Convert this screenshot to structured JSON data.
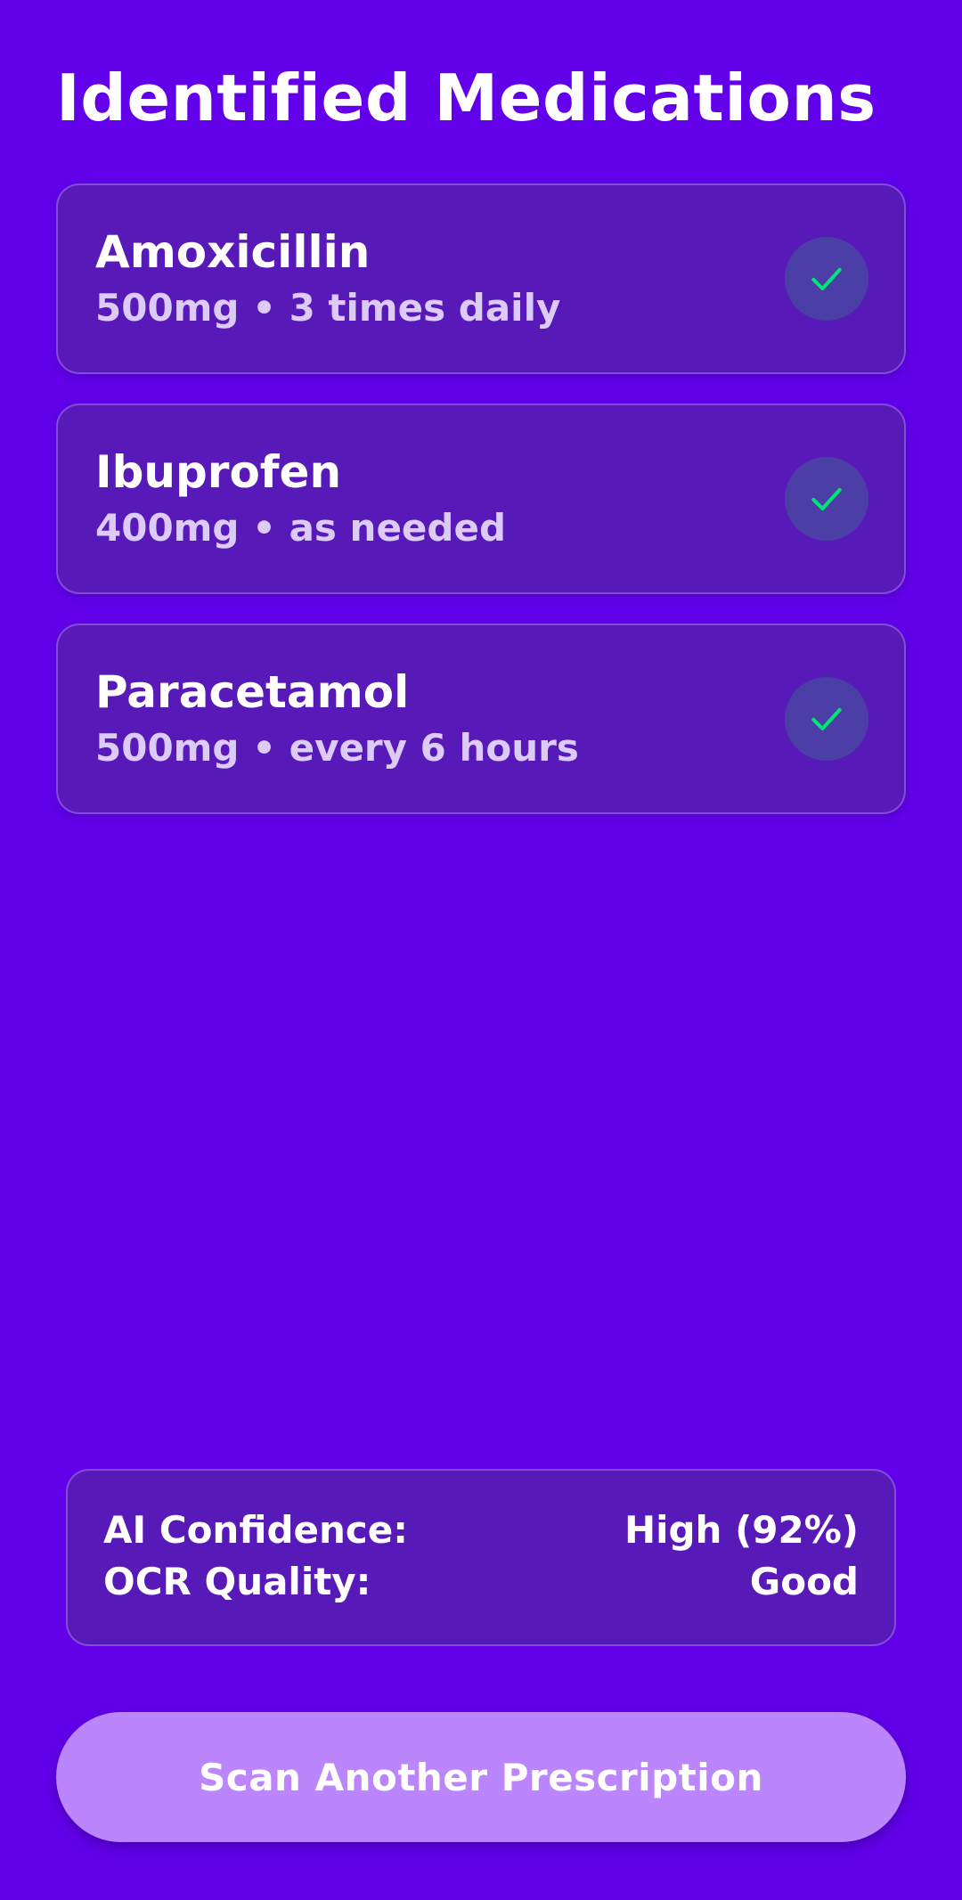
{
  "page": {
    "title": "Identified Medications"
  },
  "medications": [
    {
      "name": "Amoxicillin",
      "dosage": "500mg • 3 times daily",
      "status_icon": "check-icon"
    },
    {
      "name": "Ibuprofen",
      "dosage": "400mg • as needed",
      "status_icon": "check-icon"
    },
    {
      "name": "Paracetamol",
      "dosage": "500mg • every 6 hours",
      "status_icon": "check-icon"
    }
  ],
  "stats": {
    "ai_confidence_label": "AI Confidence:",
    "ai_confidence_value": "High (92%)",
    "ocr_quality_label": "OCR Quality:",
    "ocr_quality_value": "Good"
  },
  "actions": {
    "scan_another_label": "Scan Another Prescription"
  },
  "colors": {
    "background": "#6200ea",
    "card": "#5819b9",
    "check": "#00e676",
    "button": "#bb86fc"
  }
}
